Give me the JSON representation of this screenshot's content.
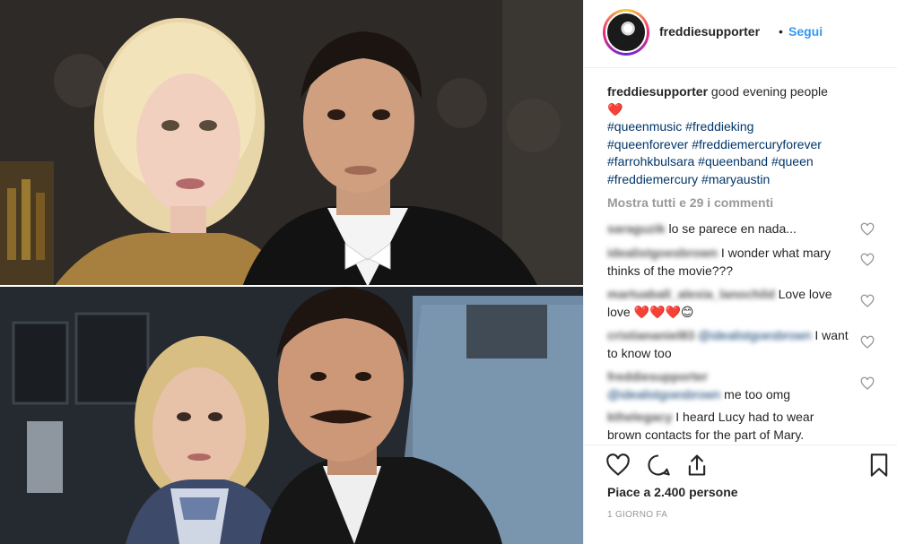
{
  "post": {
    "username": "freddiesupporter",
    "dot": "•",
    "follow_label": "Segui"
  },
  "caption": {
    "username": "freddiesupporter",
    "text": "good evening people",
    "heart": "❤️",
    "hashtags": [
      "#queenmusic",
      "#freddieking",
      "#queenforever",
      "#freddiemercuryforever",
      "#farrohkbulsara",
      "#queenband",
      "#queen",
      "#freddiemercury",
      "#maryaustin"
    ]
  },
  "view_all_comments": "Mostra tutti e 29 i commenti",
  "comments": [
    {
      "user": "saraguzik",
      "text": "lo se parece en nada..."
    },
    {
      "user": "idealistgoesbrown",
      "text": "I wonder what mary thinks of the movie???"
    },
    {
      "user": "martuaball_alexia_lanochild",
      "text": "Love love love",
      "emoji": "❤️❤️❤️😊"
    },
    {
      "user": "cristiananiel83",
      "mention": "@idealistgoesbrown",
      "text": "I want to know too"
    },
    {
      "user": "freddiesupporter",
      "mention": "@idealistgoesbrown",
      "text": "me too omg"
    },
    {
      "user": "kthelegacy",
      "text": "I heard Lucy had to wear brown contacts for the part of Mary."
    }
  ],
  "actions": {
    "likes": "Piace a 2.400 persone",
    "timestamp": "1 GIORNO FA"
  },
  "colors": {
    "link": "#3897f0",
    "hashtag": "#003569",
    "heart": "#ed4956",
    "muted": "#999999"
  },
  "icons": [
    "heart-icon",
    "comment-icon",
    "share-icon",
    "bookmark-icon"
  ]
}
